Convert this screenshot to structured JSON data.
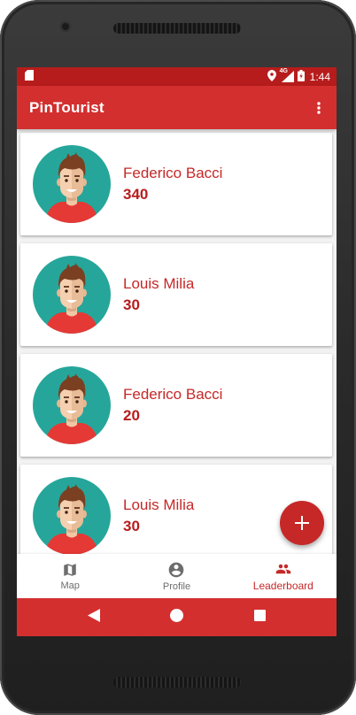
{
  "status_bar": {
    "time": "1:44",
    "network": "4G"
  },
  "app_bar": {
    "title": "PinTourist"
  },
  "leaderboard": [
    {
      "name": "Federico Bacci",
      "score": "340"
    },
    {
      "name": "Louis Milia",
      "score": "30"
    },
    {
      "name": "Federico Bacci",
      "score": "20"
    },
    {
      "name": "Louis Milia",
      "score": "30"
    }
  ],
  "fab": {
    "icon": "plus-icon"
  },
  "bottom_nav": {
    "items": [
      {
        "label": "Map",
        "icon": "map-icon",
        "active": false
      },
      {
        "label": "Profile",
        "icon": "account-circle-icon",
        "active": false
      },
      {
        "label": "Leaderboard",
        "icon": "people-icon",
        "active": true
      }
    ]
  },
  "colors": {
    "primary": "#d32f2f",
    "primary_dark": "#b71c1c",
    "accent": "#c62828",
    "avatar_bg": "#26a69a"
  }
}
